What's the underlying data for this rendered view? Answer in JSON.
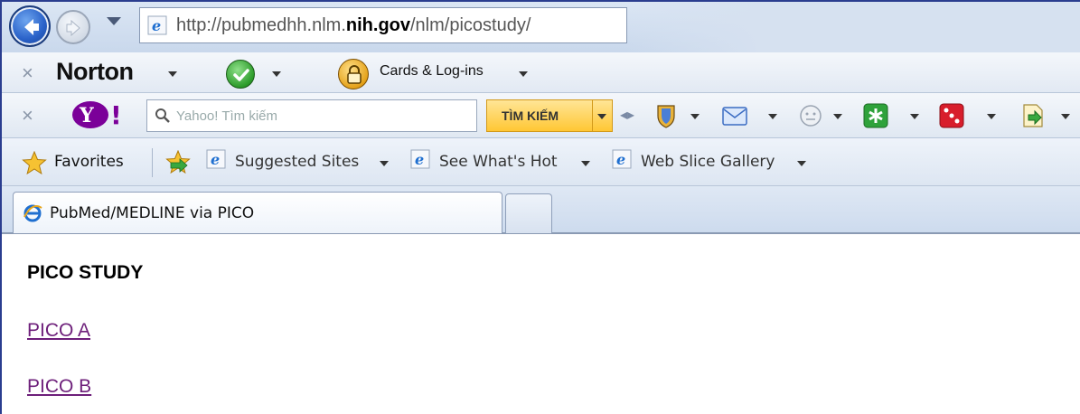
{
  "address_bar": {
    "url_prefix": "http://pubmedhh.nlm.",
    "url_bold": "nih.gov",
    "url_suffix": "/nlm/picostudy/"
  },
  "norton_toolbar": {
    "logo": "Norton",
    "cards_label": "Cards & Log-ins"
  },
  "yahoo_toolbar": {
    "search_placeholder": "Yahoo! Tìm kiếm",
    "search_button": "TÌM KIẾM",
    "tools": [
      "shield-icon",
      "mail-icon",
      "smiley-icon",
      "asterisk-icon",
      "dice-icon",
      "bookmark-arrow-icon"
    ]
  },
  "favorites_bar": {
    "favorites_label": "Favorites",
    "links": [
      {
        "label": "Suggested Sites"
      },
      {
        "label": "See What's Hot"
      },
      {
        "label": "Web Slice Gallery"
      }
    ]
  },
  "tabs": {
    "active_label": "PubMed/MEDLINE via PICO"
  },
  "page": {
    "title": "PICO STUDY",
    "links": [
      {
        "label": "PICO A"
      },
      {
        "label": "PICO B"
      }
    ]
  },
  "colors": {
    "link_visited": "#6d1f7a",
    "frame_border": "#2a3d8f",
    "yahoo_button": "#ffc734"
  }
}
